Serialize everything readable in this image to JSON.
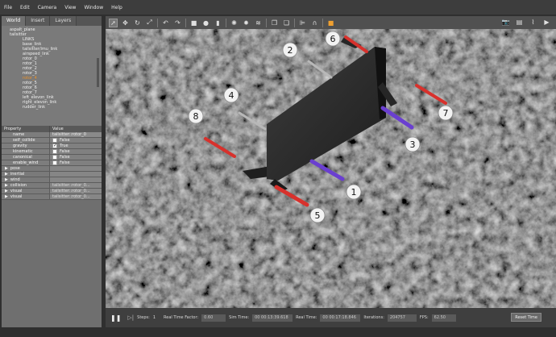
{
  "menu": [
    "File",
    "Edit",
    "Camera",
    "View",
    "Window",
    "Help"
  ],
  "tabs": [
    "World",
    "Insert",
    "Layers"
  ],
  "tree": [
    {
      "label": "aspalt_plane",
      "level": 0,
      "hl": false
    },
    {
      "label": "tailsitter",
      "level": 0,
      "hl": false
    },
    {
      "label": "LINKS",
      "level": 2,
      "hl": false
    },
    {
      "label": "base_link",
      "level": 2,
      "hl": false
    },
    {
      "label": "tailsitter/imu_link",
      "level": 2,
      "hl": false
    },
    {
      "label": "airspeed_link",
      "level": 2,
      "hl": false
    },
    {
      "label": "rotor_0",
      "level": 2,
      "hl": false
    },
    {
      "label": "rotor_1",
      "level": 2,
      "hl": false
    },
    {
      "label": "rotor_2",
      "level": 2,
      "hl": false
    },
    {
      "label": "rotor_3",
      "level": 2,
      "hl": false
    },
    {
      "label": "rotor_4",
      "level": 2,
      "hl": true
    },
    {
      "label": "rotor_5",
      "level": 2,
      "hl": false
    },
    {
      "label": "rotor_6",
      "level": 2,
      "hl": false
    },
    {
      "label": "rotor_7",
      "level": 2,
      "hl": false
    },
    {
      "label": "left_elevon_link",
      "level": 2,
      "hl": false
    },
    {
      "label": "right_elevon_link",
      "level": 2,
      "hl": false
    },
    {
      "label": "rudder_link",
      "level": 2,
      "hl": false
    }
  ],
  "props_header": {
    "property": "Property",
    "value": "Value"
  },
  "props": [
    {
      "key": "name",
      "value": "tailsitter::rotor_0",
      "type": "field"
    },
    {
      "key": "self_collide",
      "value": "False",
      "type": "check",
      "checked": false
    },
    {
      "key": "gravity",
      "value": "True",
      "type": "check",
      "checked": true
    },
    {
      "key": "kinematic",
      "value": "False",
      "type": "check",
      "checked": false
    },
    {
      "key": "canonical",
      "value": "False",
      "type": "check",
      "checked": false
    },
    {
      "key": "enable_wind",
      "value": "False",
      "type": "check",
      "checked": false
    }
  ],
  "groups": [
    {
      "key": "pose",
      "value": ""
    },
    {
      "key": "inertial",
      "value": ""
    },
    {
      "key": "wind",
      "value": ""
    },
    {
      "key": "collision",
      "value": "tailsitter::rotor_0..."
    },
    {
      "key": "visual",
      "value": "tailsitter::rotor_0..."
    },
    {
      "key": "visual",
      "value": "tailsitter::rotor_0..."
    }
  ],
  "bottom": {
    "steps_label": "Steps:",
    "steps_value": "1",
    "rtf_label": "Real Time Factor:",
    "rtf_value": "0.60",
    "sim_label": "Sim Time:",
    "sim_value": "00 00:13:39.618",
    "real_label": "Real Time:",
    "real_value": "00 00:17:18.846",
    "iter_label": "Iterations:",
    "iter_value": "204757",
    "fps_label": "FPS:",
    "fps_value": "62.50",
    "reset_label": "Reset Time"
  },
  "rotor_labels": [
    "1",
    "2",
    "3",
    "4",
    "5",
    "6",
    "7",
    "8"
  ],
  "colors": {
    "red": "#d8312c",
    "purple": "#6a3fd0",
    "grey_rotor": "#b8b8b8",
    "orange_hl": "#e8912c"
  }
}
